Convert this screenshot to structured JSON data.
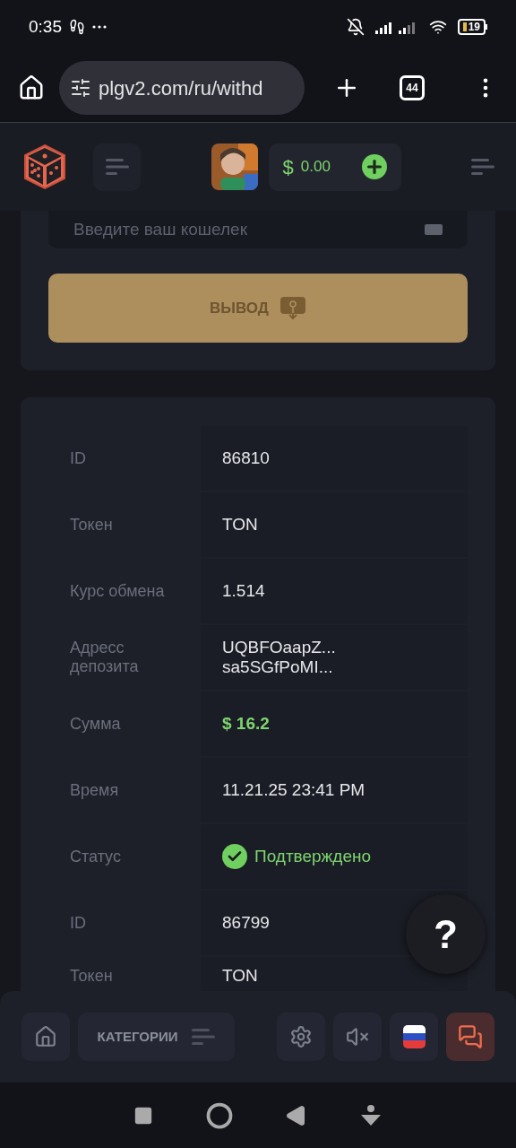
{
  "status_bar": {
    "time": "0:35",
    "battery": "19"
  },
  "browser": {
    "url": "plgv2.com/ru/withd",
    "tab_count": "44"
  },
  "header": {
    "currency": "$",
    "balance": "0.00"
  },
  "withdraw_form": {
    "wallet_placeholder": "Введите ваш кошелек",
    "button": "ВЫВОД"
  },
  "transactions": [
    {
      "fields": [
        {
          "kind": "text",
          "label": "ID",
          "value": "86810"
        },
        {
          "kind": "text",
          "label": "Токен",
          "value": "TON"
        },
        {
          "kind": "text",
          "label": "Курс обмена",
          "value": "1.514"
        },
        {
          "kind": "address",
          "label": "Адресс депозита",
          "lines": [
            "UQBFOaapZ...",
            "sa5SGfPoMI..."
          ]
        },
        {
          "kind": "amount",
          "label": "Сумма",
          "value": "$ 16.2"
        },
        {
          "kind": "text",
          "label": "Время",
          "value": "11.21.25 23:41 PM"
        },
        {
          "kind": "status",
          "label": "Статус",
          "value": "Подтверждено"
        }
      ]
    },
    {
      "fields": [
        {
          "kind": "text",
          "label": "ID",
          "value": "86799"
        },
        {
          "kind": "text",
          "label": "Токен",
          "value": "TON"
        }
      ]
    }
  ],
  "help_button": "?",
  "bottom_nav": {
    "categories": "КАТЕГОРИИ"
  }
}
